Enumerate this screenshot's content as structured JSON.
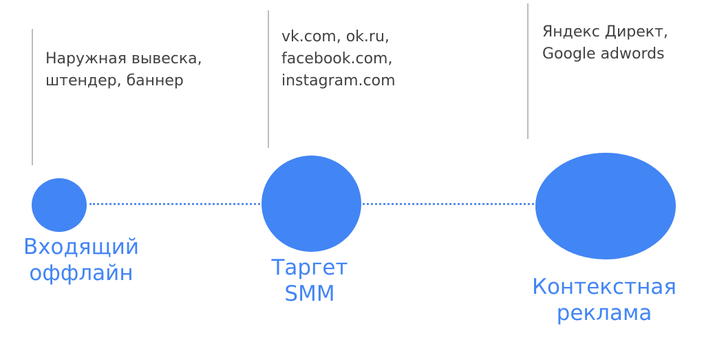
{
  "stages": [
    {
      "title": [
        "Входящий",
        "оффлайн"
      ],
      "description": [
        "Наружная вывеска,",
        "штендер, баннер"
      ]
    },
    {
      "title": [
        "Таргет",
        "SMM"
      ],
      "description": [
        "vk.com, ok.ru,",
        "facebook.com,",
        "instagram.com"
      ]
    },
    {
      "title": [
        "Контекстная",
        "реклама"
      ],
      "description": [
        "Яндекс Директ,",
        "Google adwords"
      ]
    }
  ],
  "colors": {
    "accent": "#4285f4",
    "connector": "#5b8def",
    "divider": "#bdbdbd",
    "text": "#424242"
  }
}
